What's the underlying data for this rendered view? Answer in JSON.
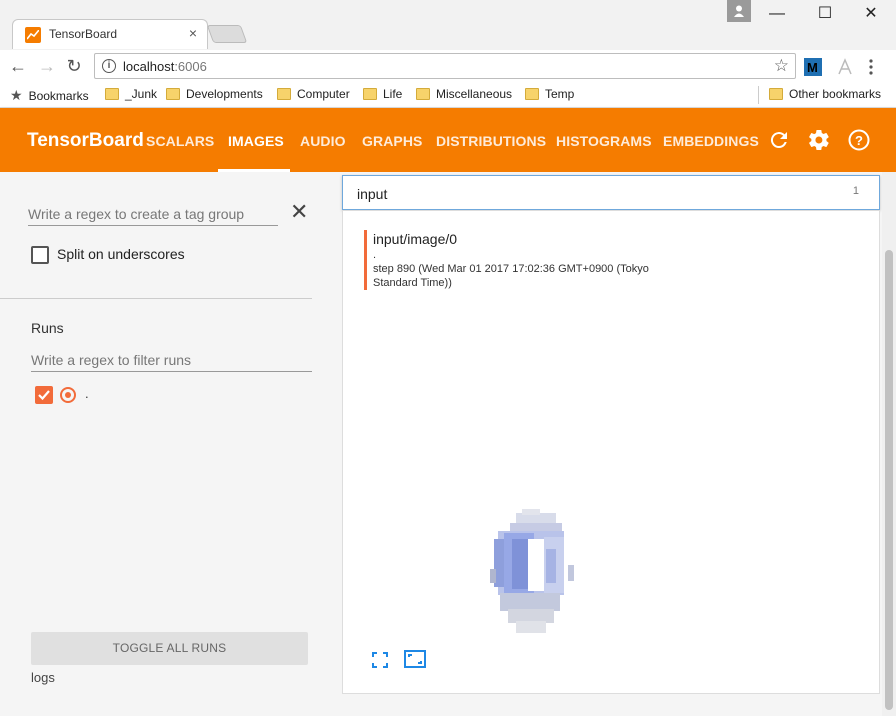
{
  "browser": {
    "tab_title": "TensorBoard",
    "tab_close": "×",
    "url_host": "localhost",
    "url_port": ":6006",
    "window_buttons": {
      "minimize": "—",
      "maximize": "☐",
      "close": "✕"
    },
    "bookmarks": [
      {
        "label": "Bookmarks",
        "icon": "star-icon"
      },
      {
        "label": "_Junk",
        "icon": "folder-icon"
      },
      {
        "label": "Developments",
        "icon": "folder-icon"
      },
      {
        "label": "Computer",
        "icon": "folder-icon"
      },
      {
        "label": "Life",
        "icon": "folder-icon"
      },
      {
        "label": "Miscellaneous",
        "icon": "folder-icon"
      },
      {
        "label": "Temp",
        "icon": "folder-icon"
      },
      {
        "label": "Other bookmarks",
        "icon": "folder-icon"
      }
    ]
  },
  "header": {
    "brand": "TensorBoard",
    "tabs": [
      {
        "label": "SCALARS"
      },
      {
        "label": "IMAGES",
        "active": true
      },
      {
        "label": "AUDIO"
      },
      {
        "label": "GRAPHS"
      },
      {
        "label": "DISTRIBUTIONS"
      },
      {
        "label": "HISTOGRAMS"
      },
      {
        "label": "EMBEDDINGS"
      }
    ],
    "accent_color": "#f57c00"
  },
  "sidebar": {
    "tag_regex_placeholder": "Write a regex to create a tag group",
    "split_label": "Split on underscores",
    "runs_title": "Runs",
    "runs_regex_placeholder": "Write a regex to filter runs",
    "run_name": ".",
    "run_color": "#f26b3a",
    "toggle_label": "TOGGLE ALL RUNS",
    "logs_label": "logs"
  },
  "main": {
    "search_value": "input",
    "search_count": "1",
    "card": {
      "tag": "input/image/0",
      "run": ".",
      "step": "step 890 (Wed Mar 01 2017 17:02:36 GMT+0900 (Tokyo Standard Time))"
    }
  }
}
